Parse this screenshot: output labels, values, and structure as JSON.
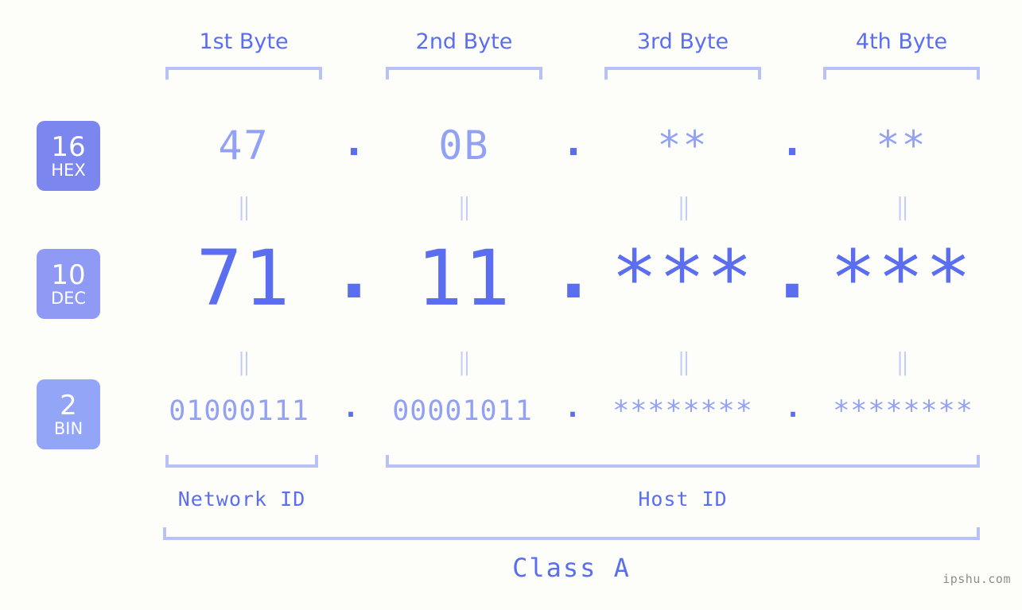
{
  "background_color": "#fdfefa",
  "accent_color": "#5b6ef0",
  "muted_color": "#93a1f5",
  "bracket_color": "#b9c2f7",
  "byte_headers": [
    {
      "label": "1st Byte"
    },
    {
      "label": "2nd Byte"
    },
    {
      "label": "3rd Byte"
    },
    {
      "label": "4th Byte"
    }
  ],
  "bases": [
    {
      "num": "16",
      "abbr": "HEX",
      "color": "#7b87ef"
    },
    {
      "num": "10",
      "abbr": "DEC",
      "color": "#8e9af4"
    },
    {
      "num": "2",
      "abbr": "BIN",
      "color": "#92a5f7"
    }
  ],
  "rows": {
    "hex": {
      "values": [
        "47",
        "0B",
        "**",
        "**"
      ],
      "separator": "."
    },
    "dec": {
      "values": [
        "71",
        "11",
        "***",
        "***"
      ],
      "separator": "."
    },
    "bin": {
      "values": [
        "01000111",
        "00001011",
        "********",
        "********"
      ],
      "separator": "."
    }
  },
  "equals_glyph": "||",
  "sections": {
    "network_id": "Network ID",
    "host_id": "Host ID"
  },
  "class_label": "Class A",
  "watermark": "ipshu.com"
}
